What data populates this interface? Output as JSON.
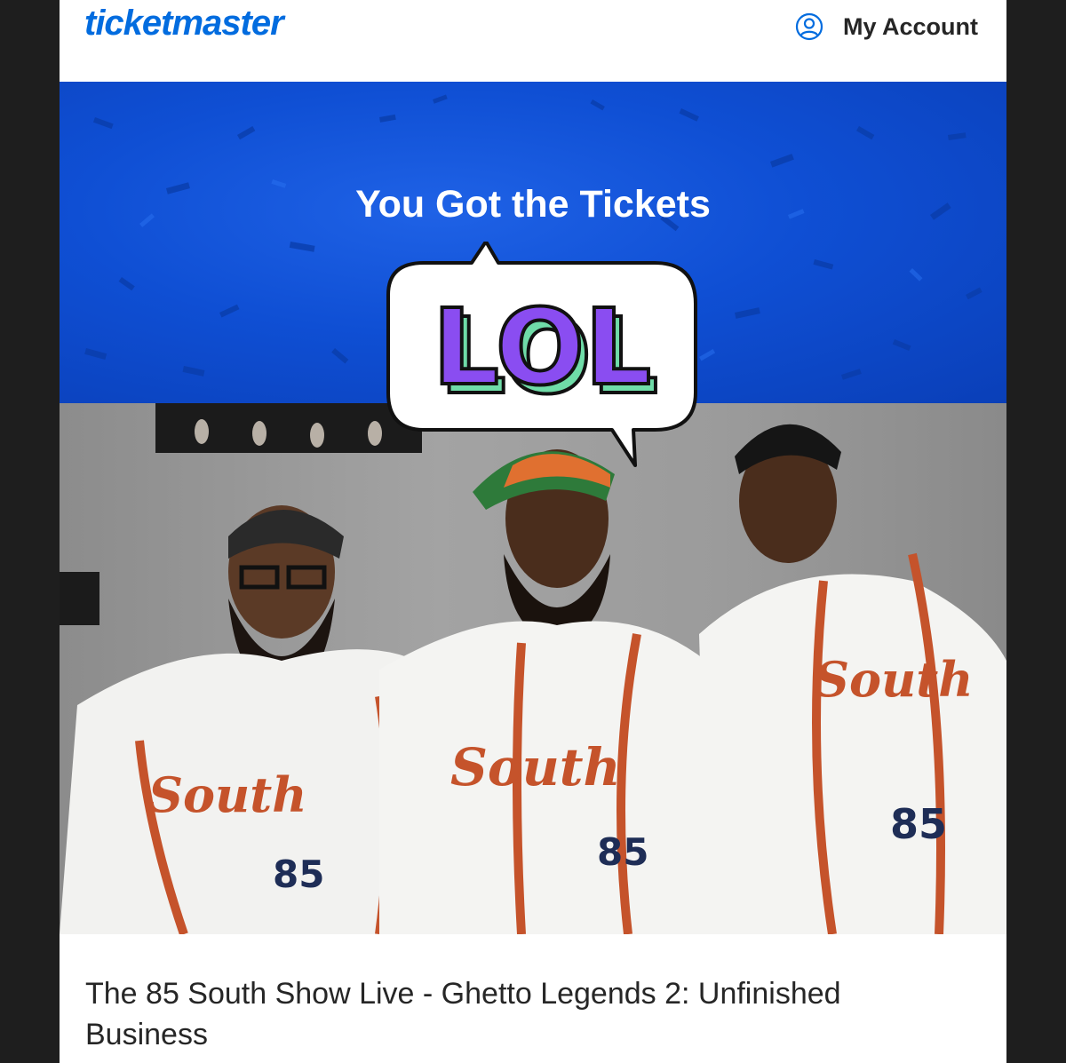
{
  "header": {
    "logo_text": "ticketmaster",
    "account_label": "My Account",
    "account_icon": "user-circle-icon",
    "brand_color": "#026cdf"
  },
  "hero": {
    "title": "You Got the Tickets",
    "sticker_text": "LOL",
    "background_color": "#0f4fd4"
  },
  "photo": {
    "jersey_text": "South",
    "jersey_number": "85"
  },
  "event": {
    "title": "The 85 South Show Live - Ghetto Legends 2: Unfinished Business"
  }
}
